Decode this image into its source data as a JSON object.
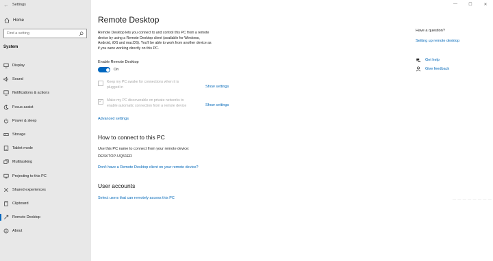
{
  "app": {
    "title": "Settings",
    "back_glyph": "←"
  },
  "sidebar": {
    "home_label": "Home",
    "search_placeholder": "Find a setting",
    "section_label": "System",
    "items": [
      {
        "label": "Display",
        "icon": "display-icon"
      },
      {
        "label": "Sound",
        "icon": "sound-icon"
      },
      {
        "label": "Notifications & actions",
        "icon": "notifications-icon"
      },
      {
        "label": "Focus assist",
        "icon": "focus-assist-icon"
      },
      {
        "label": "Power & sleep",
        "icon": "power-icon"
      },
      {
        "label": "Storage",
        "icon": "storage-icon"
      },
      {
        "label": "Tablet mode",
        "icon": "tablet-icon"
      },
      {
        "label": "Multitasking",
        "icon": "multitasking-icon"
      },
      {
        "label": "Projecting to this PC",
        "icon": "projecting-icon"
      },
      {
        "label": "Shared experiences",
        "icon": "shared-experiences-icon"
      },
      {
        "label": "Clipboard",
        "icon": "clipboard-icon"
      },
      {
        "label": "Remote Desktop",
        "icon": "remote-desktop-icon",
        "active": true
      },
      {
        "label": "About",
        "icon": "about-icon"
      }
    ]
  },
  "main": {
    "title": "Remote Desktop",
    "intro": "Remote Desktop lets you connect to and control this PC from a remote\ndevice by using a Remote Desktop client (available for Windows,\nAndroid, iOS and macOS). You'll be able to work from another device as\nif you were working directly on this PC.",
    "enable_label": "Enable Remote Desktop",
    "toggle_state": "On",
    "options": [
      {
        "text": "Keep my PC awake for connections when it is\nplugged in",
        "link": "Show settings",
        "checked": false
      },
      {
        "text": "Make my PC discoverable on private networks to\nenable automatic connection from a remote device",
        "link": "Show settings",
        "checked": true
      }
    ],
    "advanced_link": "Advanced settings",
    "connect_heading": "How to connect to this PC",
    "pc_name_label": "Use this PC name to connect from your remote device:",
    "pc_name": "DESKTOP-UQ51ER",
    "client_link": "Don't have a Remote Desktop client on your remote device?",
    "accounts_heading": "User accounts",
    "users_link": "Select users that can remotely access this PC"
  },
  "right": {
    "question": "Have a question?",
    "help_link": "Setting up remote desktop",
    "get_help": "Get help",
    "give_feedback": "Give feedback",
    "watermark": "— — — — — — — —"
  },
  "window_controls": {
    "minimize": "—",
    "maximize": "☐",
    "close": "✕"
  },
  "colors": {
    "accent": "#0067c0",
    "link": "#0067b8",
    "sidebar_bg": "#e8e8e8"
  }
}
